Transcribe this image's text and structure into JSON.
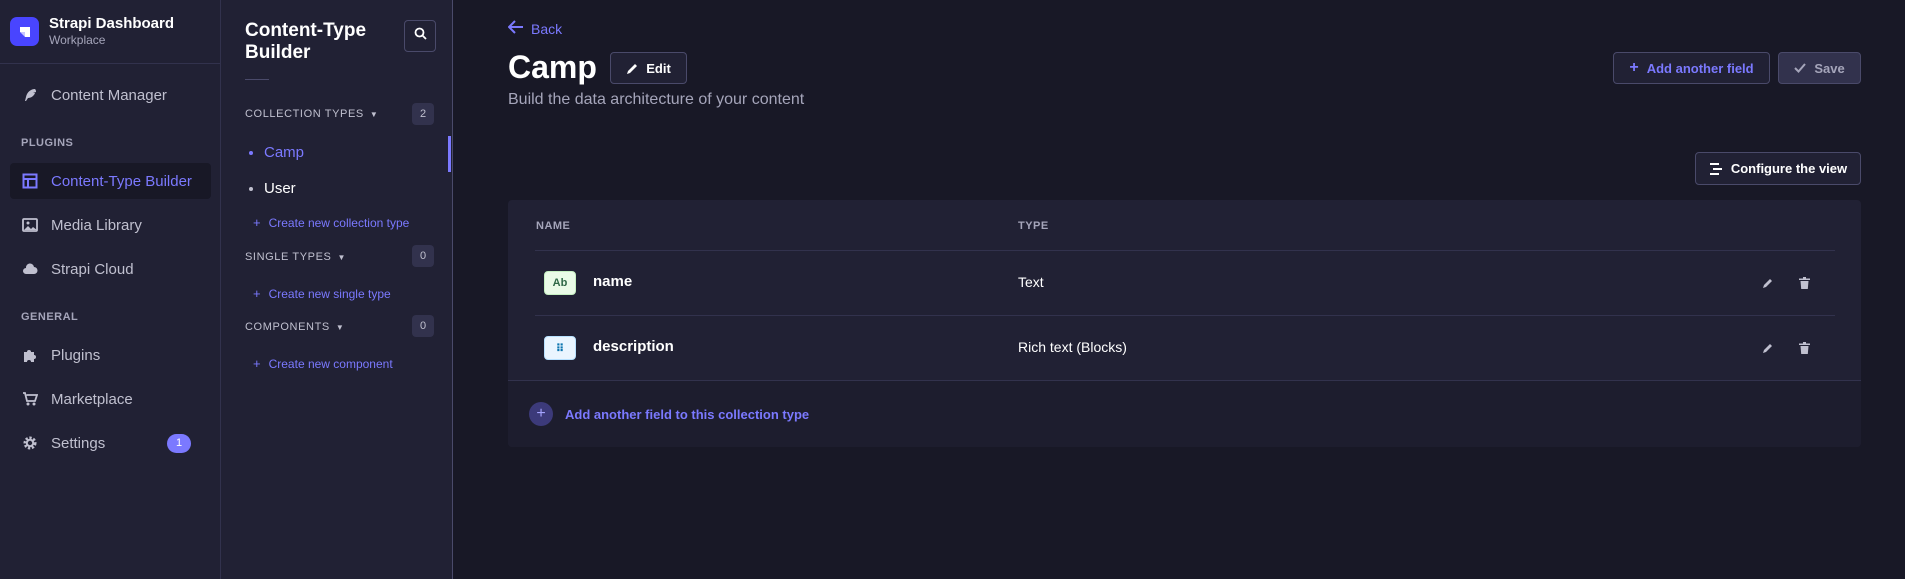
{
  "brand": {
    "title": "Strapi Dashboard",
    "subtitle": "Workplace",
    "logo_color": "#4945ff"
  },
  "mainnav": {
    "content_manager": "Content Manager",
    "plugins_section": "PLUGINS",
    "content_type_builder": "Content-Type Builder",
    "media_library": "Media Library",
    "strapi_cloud": "Strapi Cloud",
    "general_section": "GENERAL",
    "plugins": "Plugins",
    "marketplace": "Marketplace",
    "settings": "Settings",
    "settings_badge": "1"
  },
  "subnav": {
    "title": "Content-Type Builder",
    "collection_types": {
      "label": "COLLECTION TYPES",
      "count": "2",
      "items": [
        "Camp",
        "User"
      ],
      "create": "Create new collection type"
    },
    "single_types": {
      "label": "SINGLE TYPES",
      "count": "0",
      "create": "Create new single type"
    },
    "components": {
      "label": "COMPONENTS",
      "count": "0",
      "create": "Create new component"
    }
  },
  "content": {
    "back": "Back",
    "title": "Camp",
    "edit": "Edit",
    "subtitle": "Build the data architecture of your content",
    "add_field": "Add another field",
    "save": "Save",
    "configure": "Configure the view",
    "table": {
      "headers": {
        "name": "NAME",
        "type": "TYPE"
      },
      "rows": [
        {
          "icon": "Ab",
          "icon_name": "text-type-icon",
          "name": "name",
          "type": "Text"
        },
        {
          "icon": "⠿",
          "icon_name": "blocks-type-icon",
          "name": "description",
          "type": "Rich text (Blocks)"
        }
      ]
    },
    "footer_add": "Add another field to this collection type"
  },
  "colors": {
    "accent": "#7b79ff",
    "background": "#181826",
    "panel": "#212134"
  }
}
